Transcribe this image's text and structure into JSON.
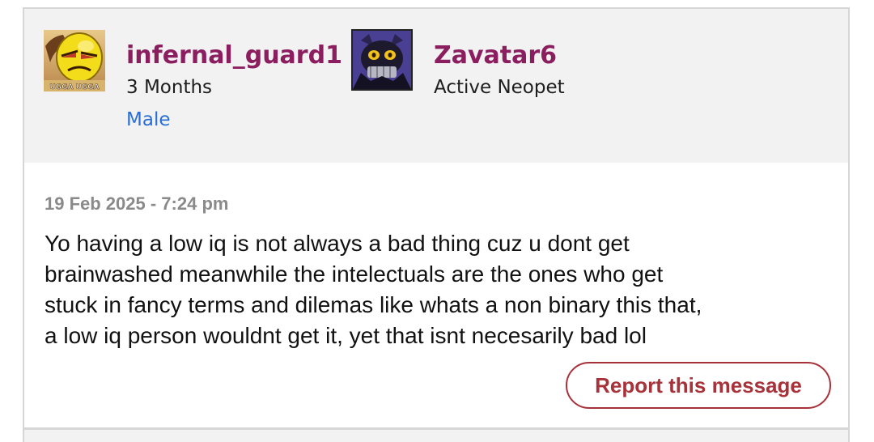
{
  "post": {
    "author": {
      "username": "infernal_guard1",
      "account_age": "3 Months",
      "gender": "Male",
      "avatar_icon": "ugga-ugga-avatar-icon",
      "avatar_text": "UGGA UGGA"
    },
    "pet": {
      "name": "Zavatar6",
      "status": "Active Neopet",
      "avatar_icon": "dark-neopet-avatar-icon"
    },
    "timestamp": "19 Feb 2025 - 7:24 pm",
    "message_lines": [
      "Yo having a low iq is not always a bad thing cuz u dont get",
      "brainwashed meanwhile the intelectuals are the ones who get",
      "stuck in fancy terms and dilemas like whats a non binary this that,",
      "a low iq person wouldnt get it, yet that isnt necesarily bad lol"
    ],
    "report_label": "Report this message"
  },
  "colors": {
    "username": "#8b1e5f",
    "gender_link": "#2b6fd6",
    "report_accent": "#a8323a",
    "header_bg": "#f2f2f2"
  }
}
